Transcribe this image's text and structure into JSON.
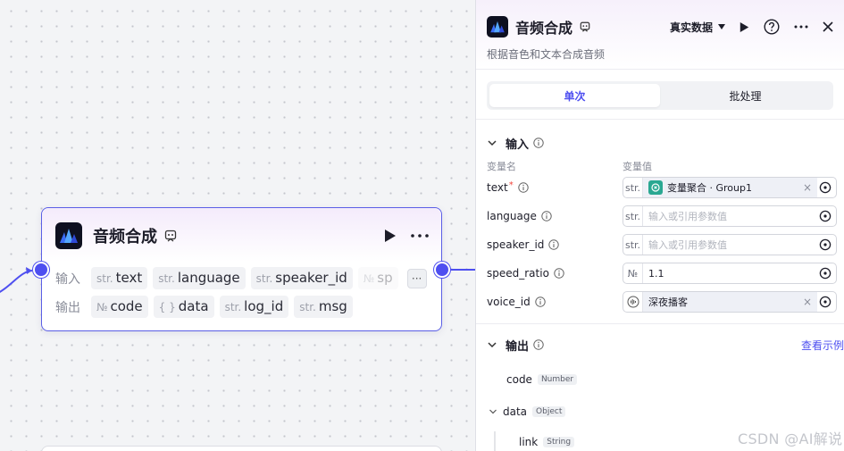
{
  "canvas": {
    "node": {
      "title": "音频合成",
      "input_label": "输入",
      "output_label": "输出",
      "inputs": [
        {
          "type": "str.",
          "name": "text"
        },
        {
          "type": "str.",
          "name": "language"
        },
        {
          "type": "str.",
          "name": "speaker_id"
        },
        {
          "type": "№",
          "name": "sp"
        }
      ],
      "outputs": [
        {
          "type": "№",
          "name": "code"
        },
        {
          "type": "{ }",
          "name": "data"
        },
        {
          "type": "str.",
          "name": "log_id"
        },
        {
          "type": "str.",
          "name": "msg"
        }
      ],
      "more_label": "···"
    }
  },
  "panel": {
    "title": "音频合成",
    "description": "根据音色和文本合成音频",
    "data_source": "真实数据",
    "tabs": [
      {
        "label": "单次",
        "active": true
      },
      {
        "label": "批处理",
        "active": false
      }
    ],
    "input_section": {
      "title": "输入",
      "col_name": "变量名",
      "col_value": "变量值",
      "params": [
        {
          "name": "text",
          "required": true,
          "type": "str.",
          "value": "变量聚合 · Group1",
          "placeholder": "",
          "kind": "variable"
        },
        {
          "name": "language",
          "required": false,
          "type": "str.",
          "value": "",
          "placeholder": "输入或引用参数值",
          "kind": "empty"
        },
        {
          "name": "speaker_id",
          "required": false,
          "type": "str.",
          "value": "",
          "placeholder": "输入或引用参数值",
          "kind": "empty"
        },
        {
          "name": "speed_ratio",
          "required": false,
          "type": "№",
          "value": "1.1",
          "placeholder": "",
          "kind": "plain"
        },
        {
          "name": "voice_id",
          "required": false,
          "type": "voice",
          "value": "深夜播客",
          "placeholder": "",
          "kind": "voice"
        }
      ]
    },
    "output_section": {
      "title": "输出",
      "view_example": "查看示例",
      "items": [
        {
          "name": "code",
          "type": "Number"
        },
        {
          "name": "data",
          "type": "Object"
        },
        {
          "name": "link",
          "type": "String"
        }
      ]
    }
  },
  "watermark": "CSDN @AI解说",
  "colors": {
    "accent": "#4e4ff0",
    "variable_chip": "#2aa892",
    "required": "#f2443a"
  }
}
